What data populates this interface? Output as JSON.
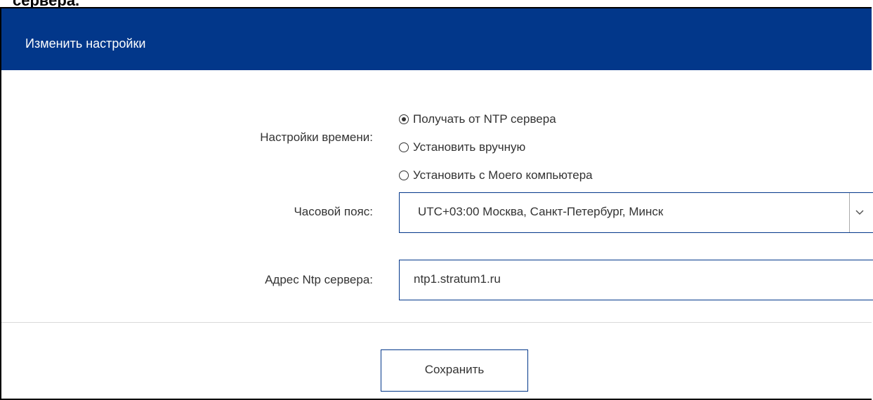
{
  "top_fragment": "сервера.",
  "dialog": {
    "title": "Изменить настройки"
  },
  "time_settings": {
    "label": "Настройки времени:",
    "options": [
      {
        "label": "Получать от NTP сервера",
        "selected": true
      },
      {
        "label": "Установить вручную",
        "selected": false
      },
      {
        "label": "Установить с Моего компьютера",
        "selected": false
      }
    ]
  },
  "timezone": {
    "label": "Часовой пояс:",
    "value": "UTC+03:00 Москва, Санкт-Петербург, Минск",
    "icon": "chevron-down-icon"
  },
  "ntp_address": {
    "label": "Адрес Ntp сервера:",
    "value": "ntp1.stratum1.ru"
  },
  "footer": {
    "save_label": "Сохранить"
  },
  "colors": {
    "header_bg": "#02378a",
    "accent_border": "#02378a"
  }
}
